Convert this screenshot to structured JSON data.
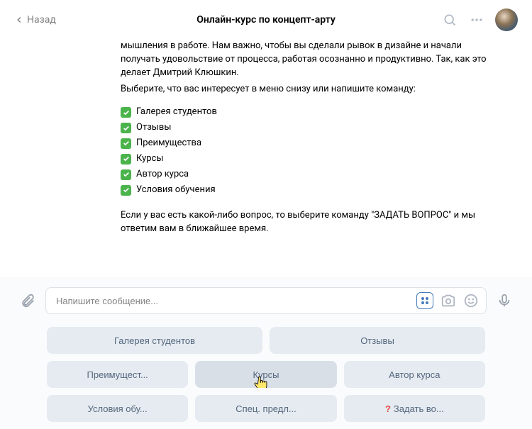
{
  "header": {
    "back_label": "Назад",
    "title": "Онлайн-курс по концепт-арту"
  },
  "message": {
    "intro": "мышления в работе. Нам важно, чтобы вы сделали рывок в дизайне и начали получать удовольствие от процесса, работая осознанно и продуктивно. Так, как это делает Дмитрий Клюшкин.",
    "prompt": "Выберите, что вас интересует в меню снизу или напишите команду:",
    "items": [
      "Галерея студентов",
      "Отзывы",
      "Преимущества",
      "Курсы",
      "Автор курса",
      "Условия обучения"
    ],
    "outro": "Если у вас есть какой-либо вопрос, то выберите команду \"ЗАДАТЬ ВОПРОС\" и мы ответим вам в ближайшее время."
  },
  "compose": {
    "placeholder": "Напишите сообщение..."
  },
  "quick_replies": {
    "row1": [
      "Галерея студентов",
      "Отзывы"
    ],
    "row2": [
      "Преимущест...",
      "Курсы",
      "Автор курса"
    ],
    "row3": [
      "Условия обу...",
      "Спец. предл...",
      "Задать во..."
    ]
  }
}
